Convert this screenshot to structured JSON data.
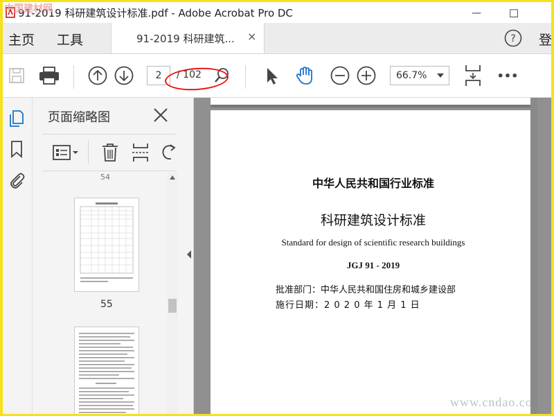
{
  "window": {
    "title": "91-2019 科研建筑设计标准.pdf - Adobe Acrobat Pro DC",
    "minimize_glyph": "—",
    "maximize_glyph": "☐"
  },
  "menu": {
    "home": "主页",
    "tools": "工具",
    "tab_label": "91-2019 科研建筑...",
    "tab_close": "×",
    "help": "?",
    "login": "登"
  },
  "toolbar": {
    "current_page": "2",
    "total_pages": "/ 102",
    "zoom": "66.7%",
    "more": "•••"
  },
  "panel": {
    "title": "页面缩略图",
    "thumb_label": "55",
    "thumb_top_label": "54"
  },
  "document": {
    "heading": "中华人民共和国行业标准",
    "title": "科研建筑设计标准",
    "title_en": "Standard for design of scientific research buildings",
    "code": "JGJ 91 - 2019",
    "dept": "批准部门：中华人民共和国住房和城乡建设部",
    "date": "施行日期：2 0 2 0 年 1 月 1 日"
  },
  "watermarks": {
    "top_left": "中国建材网",
    "bottom_right": "www.cndao.co"
  },
  "colors": {
    "frame": "#f5e11c",
    "icon_blue": "#1a73c8",
    "annotation": "#e11111"
  }
}
